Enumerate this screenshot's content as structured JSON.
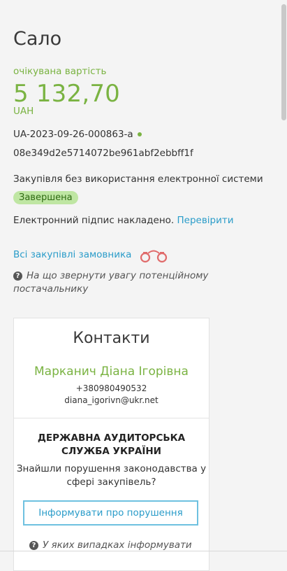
{
  "tender": {
    "title": "Сало",
    "estimated_label": "очікувана вартість",
    "amount": "5 132,70",
    "currency": "UAH",
    "tender_id": "UA-2023-09-26-000863-a",
    "hash": "08e349d2e5714072be961abf2ebbff1f",
    "procurement_type": "Закупівля без використання електронної системи",
    "status": "Завершена",
    "signature_text": "Електронний підпис накладено.",
    "signature_link": "Перевірити",
    "all_procurements_link": "Всі закупівлі замовника",
    "hint_text": "На що звернути увагу потенційному постачальнику"
  },
  "contacts": {
    "title": "Контакти",
    "name": "Марканич Діана Ігорівна",
    "phone": "+380980490532",
    "email": "diana_igorivn@ukr.net"
  },
  "audit": {
    "title": "ДЕРЖАВНА АУДИТОРСЬКА СЛУЖБА УКРАЇНИ",
    "question": "Знайшли порушення законодавства у сфері закупівель?",
    "button": "Інформувати про порушення",
    "cases_link": "У яких випадках інформувати"
  },
  "colors": {
    "accent_green": "#7ab342",
    "link_blue": "#2a9cc9",
    "badge_bg": "#bfe6a3"
  },
  "icons": [
    "status-dot-icon",
    "handcuffs-icon",
    "question-icon"
  ]
}
